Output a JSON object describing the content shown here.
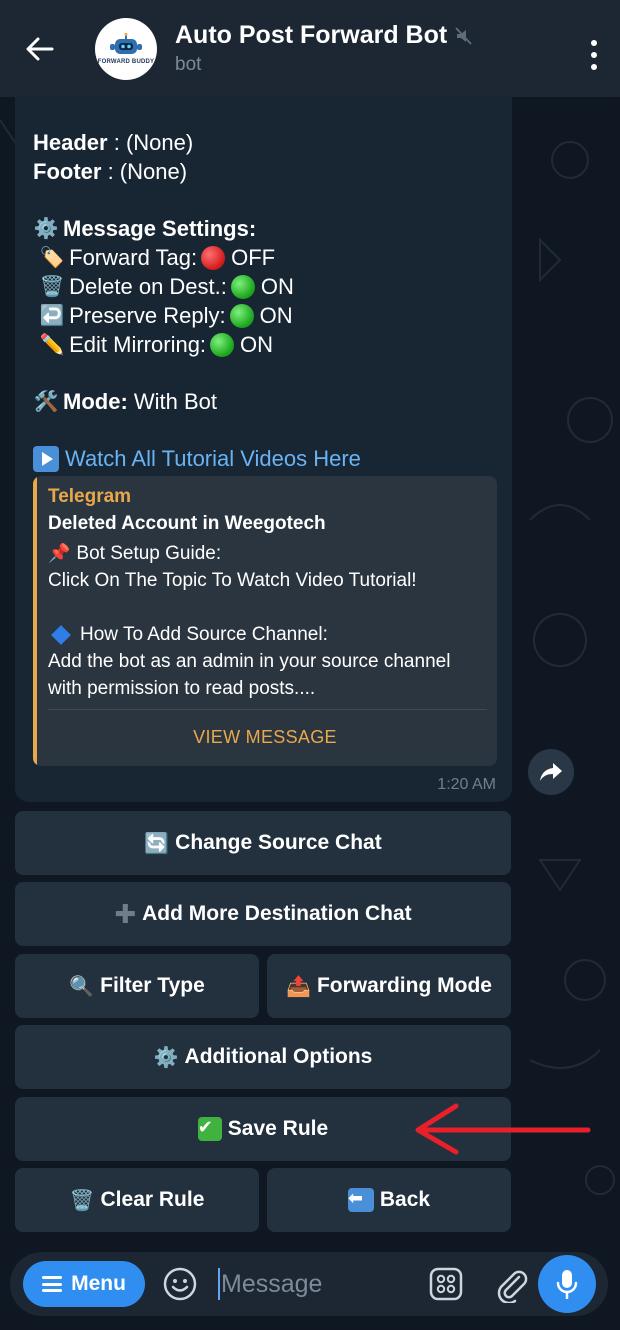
{
  "header": {
    "title": "Auto Post Forward Bot",
    "subtitle": "bot",
    "avatar_text": "FORWARD BUDDY"
  },
  "message": {
    "header_label": "Header",
    "header_value": ": (None)",
    "footer_label": "Footer",
    "footer_value": ": (None)",
    "settings_title": "Message Settings:",
    "settings": [
      {
        "emoji": "🏷️",
        "label": "Forward Tag:",
        "status": "OFF",
        "state_color": "#d11a1a"
      },
      {
        "emoji": "🗑️",
        "label": "Delete on Dest.:",
        "status": "ON",
        "state_color": "#18a318"
      },
      {
        "emoji": "↩️",
        "label": "Preserve Reply:",
        "status": "ON",
        "state_color": "#18a318"
      },
      {
        "emoji": "✏️",
        "label": "Edit Mirroring:",
        "status": "ON",
        "state_color": "#18a318"
      }
    ],
    "mode_label": "Mode:",
    "mode_value": "With Bot",
    "tutorial_link": "Watch All Tutorial Videos Here",
    "time": "1:20 AM"
  },
  "preview": {
    "site": "Telegram",
    "title": "Deleted Account in Weegotech",
    "line1": "Bot Setup Guide:",
    "line2": "Click On The Topic To Watch Video Tutorial!",
    "line3": "How To Add Source Channel:",
    "line4": "Add the bot as an admin in your source channel",
    "line5": "with permission to read posts....",
    "button": "VIEW MESSAGE",
    "accent_color": "#e8a84b"
  },
  "keyboard": {
    "change_source": "Change Source Chat",
    "add_destination": "Add More Destination Chat",
    "filter_type": "Filter Type",
    "forwarding_mode": "Forwarding Mode",
    "additional_options": "Additional Options",
    "save_rule": "Save Rule",
    "clear_rule": "Clear Rule",
    "back": "Back"
  },
  "composer": {
    "menu_label": "Menu",
    "placeholder": "Message"
  },
  "colors": {
    "background": "#0f1822",
    "header": "#1c2733",
    "bubble": "#182533",
    "button": "#23303e",
    "accent_blue": "#2f8ef0",
    "link": "#6ab3f3",
    "annotation_red": "#e8202a"
  }
}
